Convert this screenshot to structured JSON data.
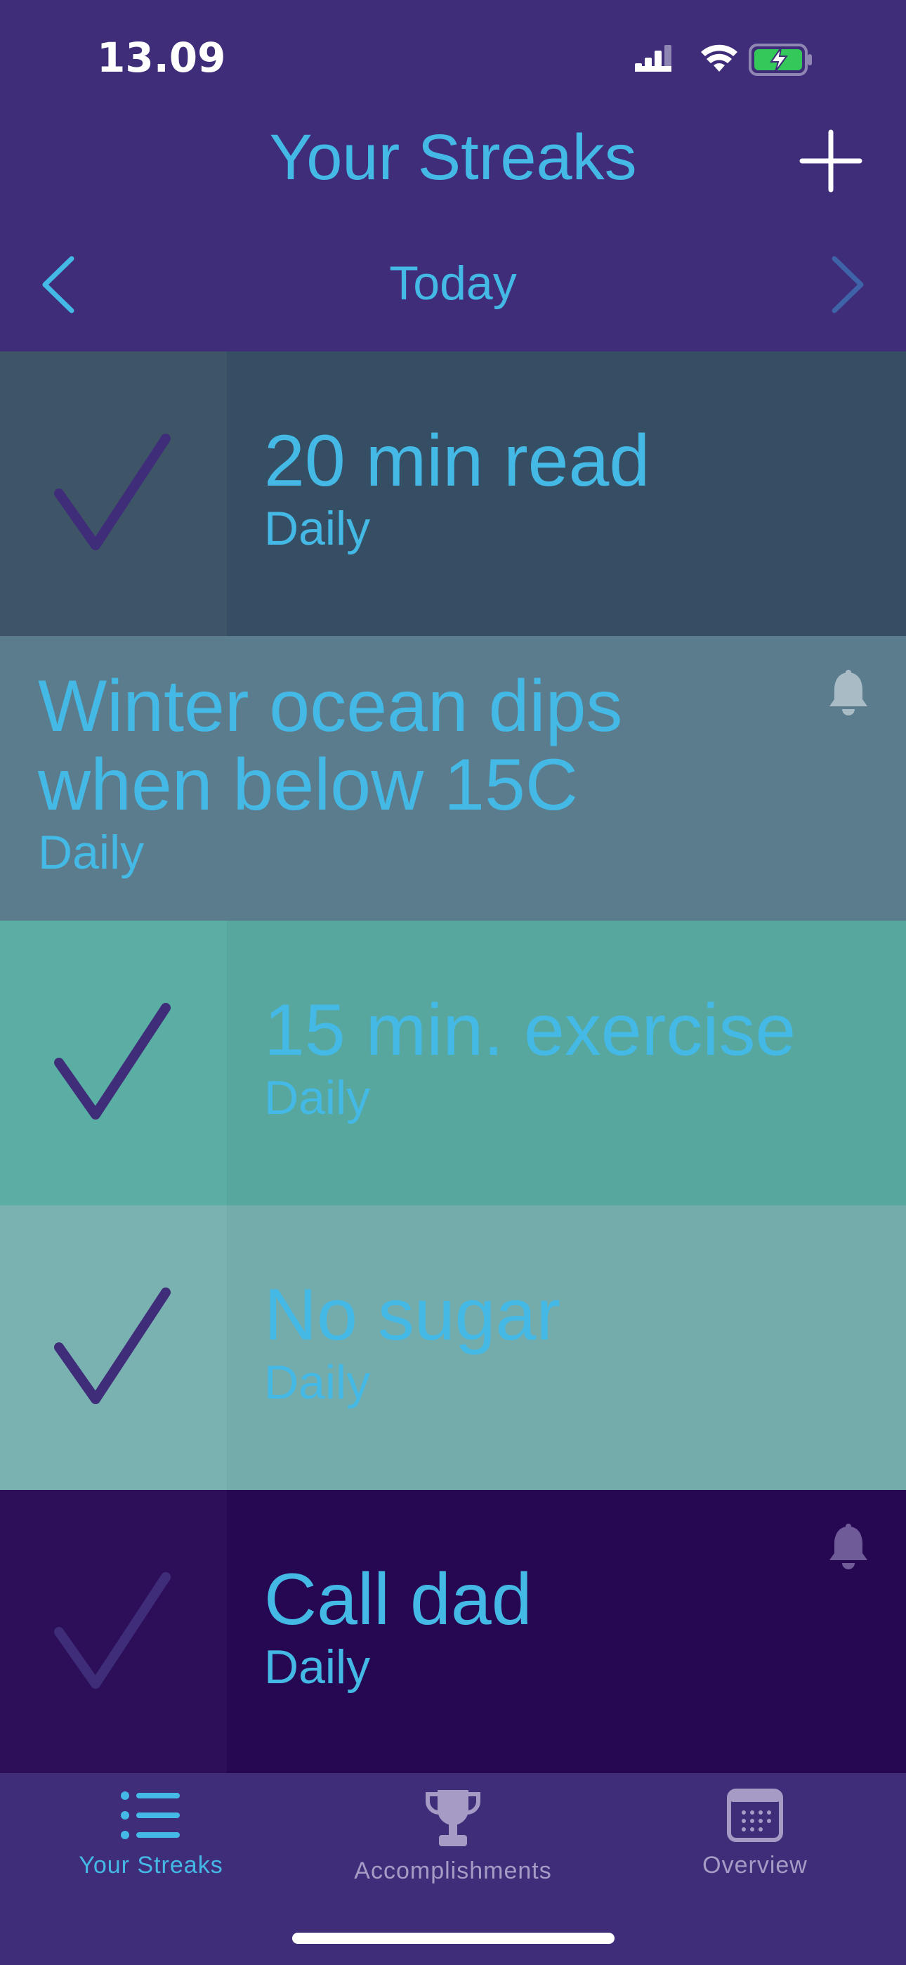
{
  "status_bar": {
    "time": "13.09"
  },
  "header": {
    "title": "Your Streaks",
    "add_icon": "plus-icon"
  },
  "date_nav": {
    "label": "Today",
    "prev_icon": "chevron-left-icon",
    "next_icon": "chevron-right-icon"
  },
  "streaks": [
    {
      "title": "20 min read",
      "frequency": "Daily",
      "completed": true,
      "reminder": false,
      "color": "#364e64"
    },
    {
      "title": "Winter ocean dips when below 15C",
      "frequency": "Daily",
      "completed": false,
      "reminder": true,
      "color": "#5a7c8c"
    },
    {
      "title": "15 min. exercise",
      "frequency": "Daily",
      "completed": true,
      "reminder": false,
      "color": "#57a79f"
    },
    {
      "title": "No sugar",
      "frequency": "Daily",
      "completed": true,
      "reminder": false,
      "color": "#74abab"
    },
    {
      "title": "Call dad",
      "frequency": "Daily",
      "completed": true,
      "reminder": true,
      "color": "#250851"
    }
  ],
  "tabbar": {
    "tabs": [
      {
        "label": "Your Streaks",
        "icon": "list-icon",
        "active": true
      },
      {
        "label": "Accomplishments",
        "icon": "trophy-icon",
        "active": false
      },
      {
        "label": "Overview",
        "icon": "calendar-icon",
        "active": false
      }
    ]
  },
  "colors": {
    "background": "#3f2d79",
    "accent": "#44b9e6",
    "checkmark": "#3f2d79",
    "inactive_tab": "#a59bc4"
  }
}
